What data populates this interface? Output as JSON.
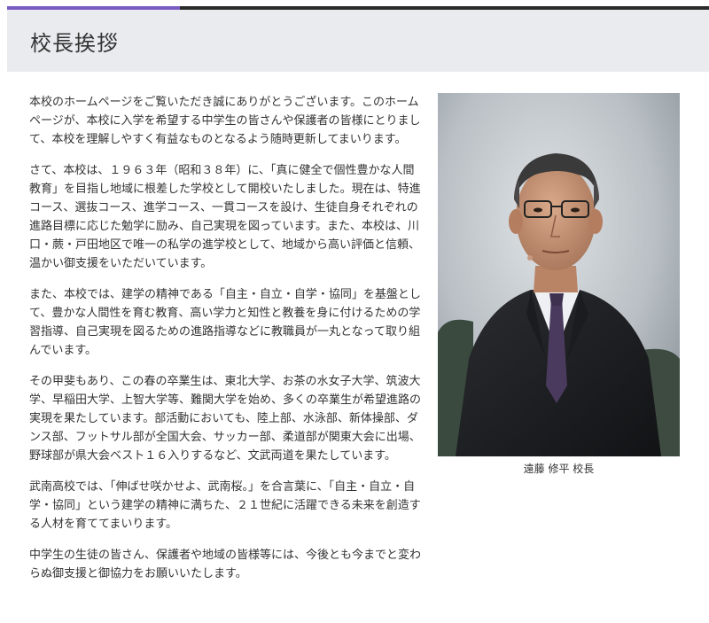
{
  "header": {
    "title": "校長挨拶"
  },
  "colors": {
    "accent": "#7a5bc2",
    "header_bg": "#e9ebee",
    "bar": "#2b2b2b"
  },
  "content": {
    "paragraphs": [
      "本校のホームページをご覧いただき誠にありがとうございます。このホームページが、本校に入学を希望する中学生の皆さんや保護者の皆様にとりまして、本校を理解しやすく有益なものとなるよう随時更新してまいります。",
      "さて、本校は、１９６３年（昭和３８年）に、「真に健全で個性豊かな人間教育」を目指し地域に根差した学校として開校いたしました。現在は、特進コース、選抜コース、進学コース、一貫コースを設け、生徒自身それぞれの進路目標に応じた勉学に励み、自己実現を図っています。また、本校は、川口・蕨・戸田地区で唯一の私学の進学校として、地域から高い評価と信頼、温かい御支援をいただいています。",
      "また、本校では、建学の精神である「自主・自立・自学・協同」を基盤として、豊かな人間性を育む教育、高い学力と知性と教養を身に付けるための学習指導、自己実現を図るための進路指導などに教職員が一丸となって取り組んでいます。",
      "その甲斐もあり、この春の卒業生は、東北大学、お茶の水女子大学、筑波大学、早稲田大学、上智大学等、難関大学を始め、多くの卒業生が希望進路の実現を果たしています。部活動においても、陸上部、水泳部、新体操部、ダンス部、フットサル部が全国大会、サッカー部、柔道部が関東大会に出場、野球部が県大会ベスト１６入りするなど、文武両道を果たしています。",
      "武南高校では、「伸ばせ咲かせよ、武南桜。」を合言葉に、「自主・自立・自学・協同」という建学の精神に満ちた、２１世紀に活躍できる未来を創造する人材を育ててまいります。",
      "中学生の生徒の皆さん、保護者や地域の皆様等には、今後とも今までと変わらぬ御支援と御協力をお願いいたします。"
    ]
  },
  "photo": {
    "caption": "遠藤 修平 校長"
  }
}
